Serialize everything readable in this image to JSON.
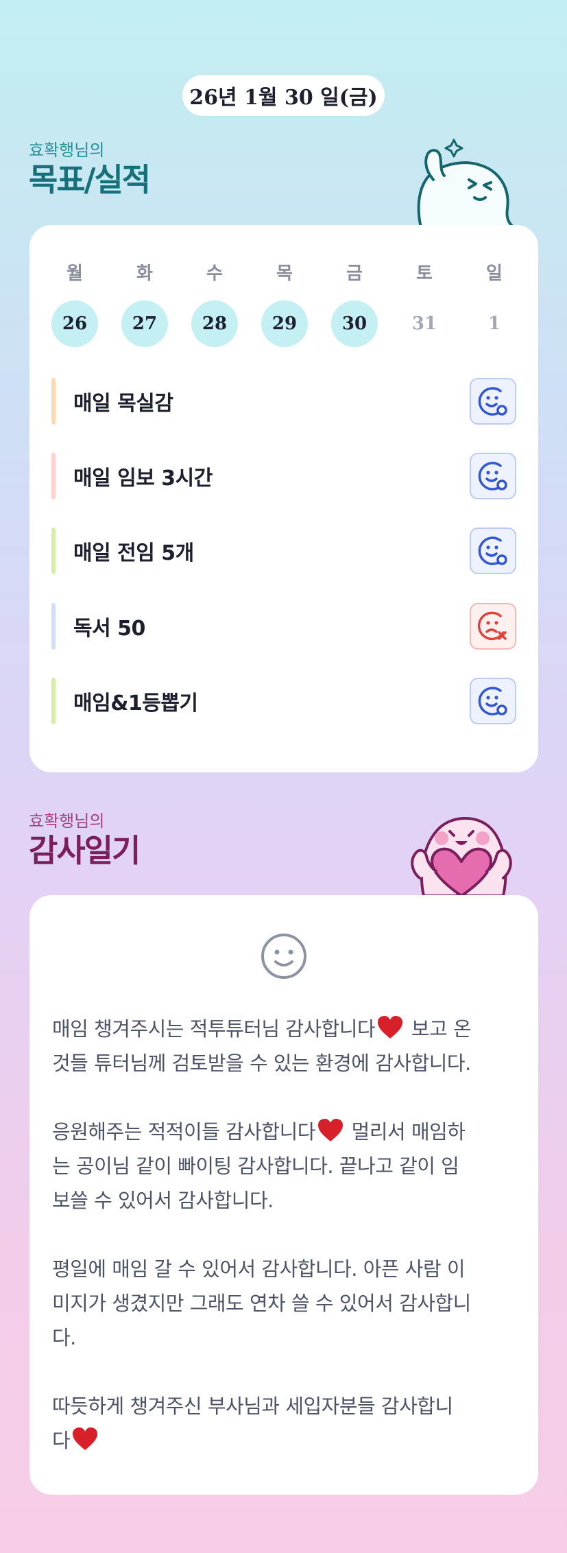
{
  "header": {
    "date": "26년 1월 30 일(금)"
  },
  "goals_section": {
    "subtitle": "효확행님의",
    "title": "목표/실적"
  },
  "calendar": {
    "weekdays": [
      "월",
      "화",
      "수",
      "목",
      "금",
      "토",
      "일"
    ],
    "days": [
      {
        "num": "26",
        "done": true
      },
      {
        "num": "27",
        "done": true
      },
      {
        "num": "28",
        "done": true
      },
      {
        "num": "29",
        "done": true
      },
      {
        "num": "30",
        "done": true
      },
      {
        "num": "31",
        "done": false
      },
      {
        "num": "1",
        "done": false
      }
    ]
  },
  "goals": [
    {
      "name": "매일 목실감",
      "bar_color": "#ffd8b2",
      "status": "done",
      "status_icon": "smile-check-icon"
    },
    {
      "name": "매일 임보 3시간",
      "bar_color": "#ffd2d0",
      "status": "done",
      "status_icon": "smile-check-icon"
    },
    {
      "name": "매일 전임 5개",
      "bar_color": "#d4f0a8",
      "status": "done",
      "status_icon": "smile-check-icon"
    },
    {
      "name": "독서 50",
      "bar_color": "#d4def8",
      "status": "failed",
      "status_icon": "sad-x-icon"
    },
    {
      "name": "매임&1등뽑기",
      "bar_color": "#d4f0a8",
      "status": "done",
      "status_icon": "smile-check-icon"
    }
  ],
  "diary_section": {
    "subtitle": "효확행님의",
    "title": "감사일기"
  },
  "diary": {
    "icon": "smiley-face-icon",
    "lines": [
      [
        "매임 챙겨주시는 적투튜터님 감사합니다",
        "heart",
        " 보고 온"
      ],
      [
        "것들 튜터님께 검토받을 수 있는 환경에 감사합니다."
      ],
      [
        "응원해주는 적적이들 감사합니다",
        "heart",
        " 멀리서 매임하"
      ],
      [
        "는 공이님 같이 빠이팅 감사합니다. 끝나고 같이 임"
      ],
      [
        "보쓸 수 있어서 감사합니다."
      ],
      [
        "평일에 매임 갈 수 있어서 감사합니다. 아픈 사람 이"
      ],
      [
        "미지가 생겼지만 그래도 연차 쓸 수 있어서 감사합니"
      ],
      [
        "다."
      ],
      [
        "따듯하게 챙겨주신 부사님과 세입자분들 감사합니"
      ],
      [
        "다",
        "heart"
      ]
    ]
  },
  "colors": {
    "accent_teal": "#16707a",
    "accent_plum": "#7a1e5c",
    "day_done": "#c4f0f3",
    "status_ok": "#3056d3",
    "status_fail": "#e0433a",
    "heart": "#d8202a"
  }
}
